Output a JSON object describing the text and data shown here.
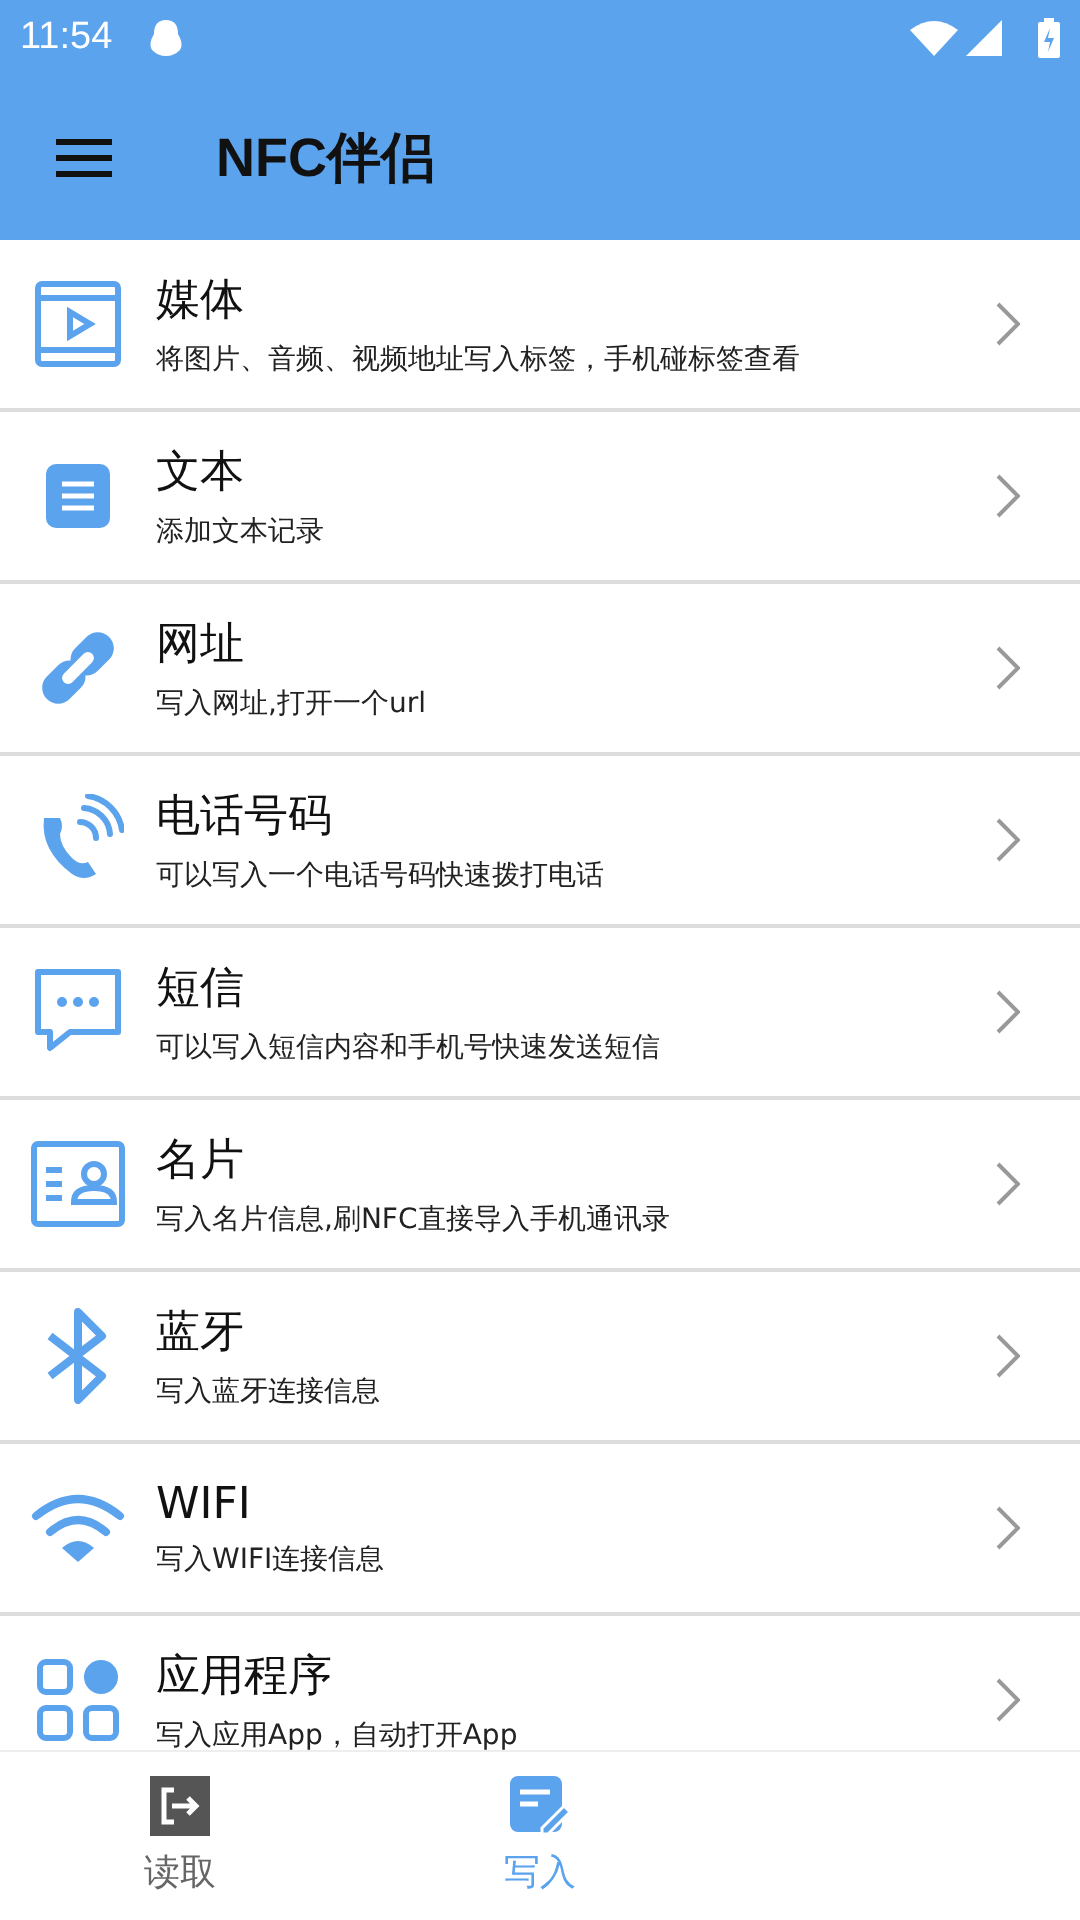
{
  "status_bar": {
    "time": "11:54"
  },
  "toolbar": {
    "title": "NFC伴侣"
  },
  "items": [
    {
      "kind": "media",
      "title": "媒体",
      "subtitle": "将图片、音频、视频地址写入标签，手机碰标签查看"
    },
    {
      "kind": "text",
      "title": "文本",
      "subtitle": "添加文本记录"
    },
    {
      "kind": "link",
      "title": "网址",
      "subtitle": "写入网址,打开一个url"
    },
    {
      "kind": "phone",
      "title": "电话号码",
      "subtitle": "可以写入一个电话号码快速拨打电话"
    },
    {
      "kind": "sms",
      "title": "短信",
      "subtitle": "可以写入短信内容和手机号快速发送短信"
    },
    {
      "kind": "card",
      "title": "名片",
      "subtitle": "写入名片信息,刷NFC直接导入手机通讯录"
    },
    {
      "kind": "bluetooth",
      "title": "蓝牙",
      "subtitle": "写入蓝牙连接信息"
    },
    {
      "kind": "wifi",
      "title": "WIFI",
      "subtitle": "写入WIFI连接信息"
    },
    {
      "kind": "apps",
      "title": "应用程序",
      "subtitle": "写入应用App，自动打开App"
    }
  ],
  "tabs": [
    {
      "kind": "read",
      "label": "读取",
      "selected": false
    },
    {
      "kind": "write",
      "label": "写入",
      "selected": true
    }
  ]
}
